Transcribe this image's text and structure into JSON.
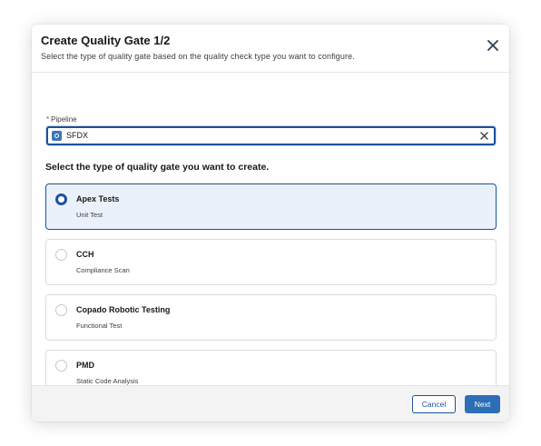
{
  "modal": {
    "title": "Create Quality Gate 1/2",
    "subtitle": "Select the type of quality gate based on the quality check type you want to configure.",
    "close_icon": "close-icon"
  },
  "pipeline": {
    "required_marker": "*",
    "label": "Pipeline",
    "value": "SFDX",
    "icon": "pipeline-icon",
    "clear_icon": "clear-icon"
  },
  "section_heading": "Select the type of quality gate you want to create.",
  "options": [
    {
      "title": "Apex Tests",
      "subtitle": "Unit Test",
      "selected": true
    },
    {
      "title": "CCH",
      "subtitle": "Compliance Scan",
      "selected": false
    },
    {
      "title": "Copado Robotic Testing",
      "subtitle": "Functional Test",
      "selected": false
    },
    {
      "title": "PMD",
      "subtitle": "Static Code Analysis",
      "selected": false
    }
  ],
  "footer": {
    "cancel_label": "Cancel",
    "next_label": "Next"
  },
  "colors": {
    "brand": "#1b5297",
    "primary_button": "#2c6fb7",
    "selected_card_bg": "#eaf1fb",
    "required": "#c23934"
  }
}
